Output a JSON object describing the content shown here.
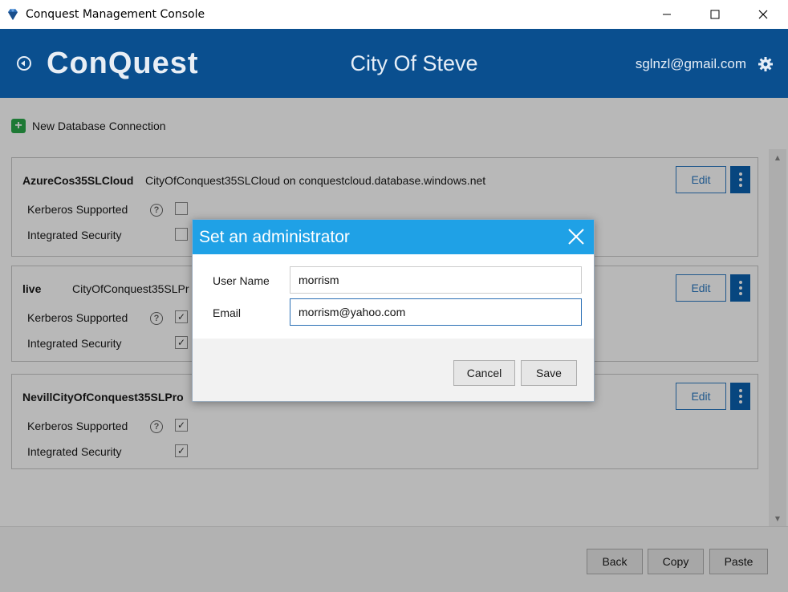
{
  "window": {
    "title": "Conquest Management Console",
    "minimize_icon": "minimize-icon",
    "maximize_icon": "maximize-icon",
    "close_icon": "close-icon"
  },
  "header": {
    "logo_text": "ConQuest",
    "city": "City Of Steve",
    "user_email": "sglnzl@gmail.com",
    "colors": {
      "header_bg": "#0a4f8f",
      "accent": "#1fa1e6"
    }
  },
  "content": {
    "new_connection_label": "New Database Connection",
    "connections": [
      {
        "name": "AzureCos35SLCloud",
        "description": "CityOfConquest35SLCloud on conquestcloud.database.windows.net",
        "kerberos_label": "Kerberos Supported",
        "kerberos_checked": false,
        "integrated_label": "Integrated Security",
        "integrated_checked": false,
        "edit_label": "Edit"
      },
      {
        "name": "live",
        "description": "CityOfConquest35SLPr",
        "kerberos_label": "Kerberos Supported",
        "kerberos_checked": true,
        "integrated_label": "Integrated Security",
        "integrated_checked": true,
        "edit_label": "Edit"
      },
      {
        "name": "NevillCityOfConquest35SLPro",
        "description": "",
        "kerberos_label": "Kerberos Supported",
        "kerberos_checked": true,
        "integrated_label": "Integrated Security",
        "integrated_checked": true,
        "edit_label": "Edit"
      }
    ]
  },
  "footer": {
    "back_label": "Back",
    "copy_label": "Copy",
    "paste_label": "Paste"
  },
  "dialog": {
    "title": "Set an administrator",
    "username_label": "User Name",
    "username_value": "morrism",
    "email_label": "Email",
    "email_value": "morrism@yahoo.com",
    "cancel_label": "Cancel",
    "save_label": "Save"
  }
}
